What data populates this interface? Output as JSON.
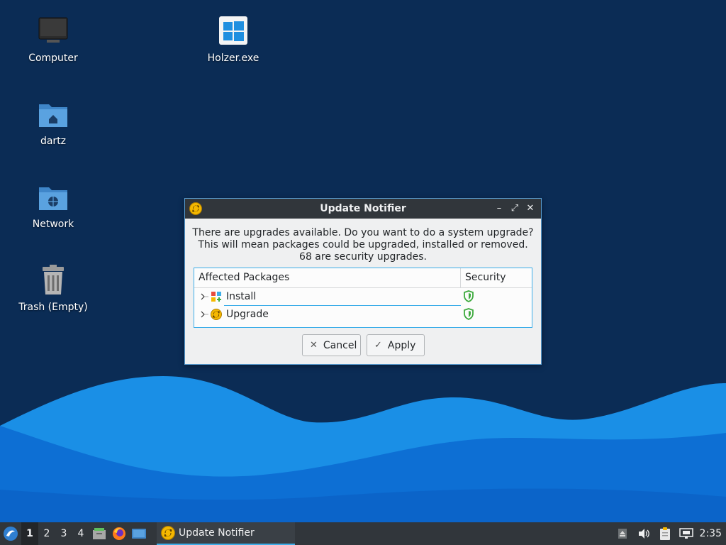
{
  "desktop": {
    "icons": [
      {
        "label": "Computer",
        "icon": "monitor-icon"
      },
      {
        "label": "Holzer.exe",
        "icon": "windows-executable-icon"
      },
      {
        "label": "dartz",
        "icon": "home-folder-icon"
      },
      {
        "label": "Network",
        "icon": "network-folder-icon"
      },
      {
        "label": "Trash (Empty)",
        "icon": "trash-icon"
      }
    ]
  },
  "dialog": {
    "title": "Update Notifier",
    "window_buttons": {
      "minimize": "–",
      "maximize": "⤢",
      "close": "✕"
    },
    "message": {
      "line1": "There are upgrades available. Do you want to do a system upgrade?",
      "line2": "This will mean packages could be upgraded, installed or removed.",
      "line3": "68 are security upgrades."
    },
    "tree": {
      "columns": {
        "packages": "Affected Packages",
        "security": "Security"
      },
      "rows": [
        {
          "label": "Install",
          "icon": "package-install-icon"
        },
        {
          "label": "Upgrade",
          "icon": "upgrade-icon"
        }
      ]
    },
    "buttons": {
      "cancel": "Cancel",
      "apply": "Apply",
      "cancel_icon": "✕",
      "apply_icon": "✓"
    }
  },
  "taskbar": {
    "workspaces": [
      "1",
      "2",
      "3",
      "4"
    ],
    "active_task": "Update Notifier",
    "clock": "2:35"
  },
  "colors": {
    "accent": "#3daee9",
    "titlebar": "#31363b",
    "shield": "#3daa3d"
  }
}
